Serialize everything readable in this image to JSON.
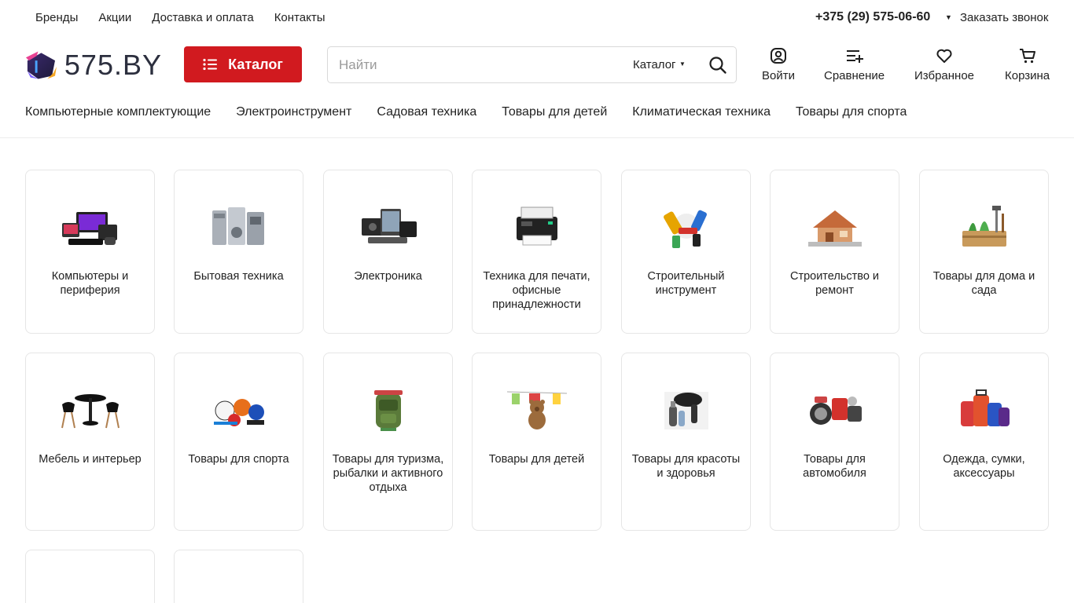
{
  "topbar": {
    "links": [
      "Бренды",
      "Акции",
      "Доставка и оплата",
      "Контакты"
    ],
    "phone": "+375 (29) 575-06-60",
    "callback": "Заказать звонок"
  },
  "header": {
    "logo_text": "575.BY",
    "catalog_button": "Каталог",
    "search": {
      "placeholder": "Найти",
      "scope": "Каталог"
    },
    "actions": {
      "login": "Войти",
      "compare": "Сравнение",
      "favorites": "Избранное",
      "cart": "Корзина"
    },
    "brand_color": "#d11a1f"
  },
  "nav": {
    "items": [
      "Компьютерные комплектующие",
      "Электроинструмент",
      "Садовая техника",
      "Товары для детей",
      "Климатическая техника",
      "Товары для спорта"
    ]
  },
  "categories": [
    {
      "name": "Компьютеры и периферия",
      "icon": "computers-image"
    },
    {
      "name": "Бытовая техника",
      "icon": "appliances-image"
    },
    {
      "name": "Электроника",
      "icon": "electronics-image"
    },
    {
      "name": "Техника для печати, офисные принадлежности",
      "icon": "printer-image"
    },
    {
      "name": "Строительный инструмент",
      "icon": "power-tools-image"
    },
    {
      "name": "Строительство и ремонт",
      "icon": "house-construction-image"
    },
    {
      "name": "Товары для дома и сада",
      "icon": "garden-tools-image"
    },
    {
      "name": "Мебель и интерьер",
      "icon": "furniture-image"
    },
    {
      "name": "Товары для спорта",
      "icon": "sports-balls-image"
    },
    {
      "name": "Товары для туризма, рыбалки и активного отдыха",
      "icon": "backpack-image"
    },
    {
      "name": "Товары для детей",
      "icon": "teddy-bear-image"
    },
    {
      "name": "Товары для красоты и здоровья",
      "icon": "hair-dryer-image"
    },
    {
      "name": "Товары для автомобиля",
      "icon": "car-parts-image"
    },
    {
      "name": "Одежда, сумки, аксессуары",
      "icon": "suitcases-image"
    },
    {
      "name": "",
      "icon": ""
    },
    {
      "name": "",
      "icon": ""
    }
  ]
}
